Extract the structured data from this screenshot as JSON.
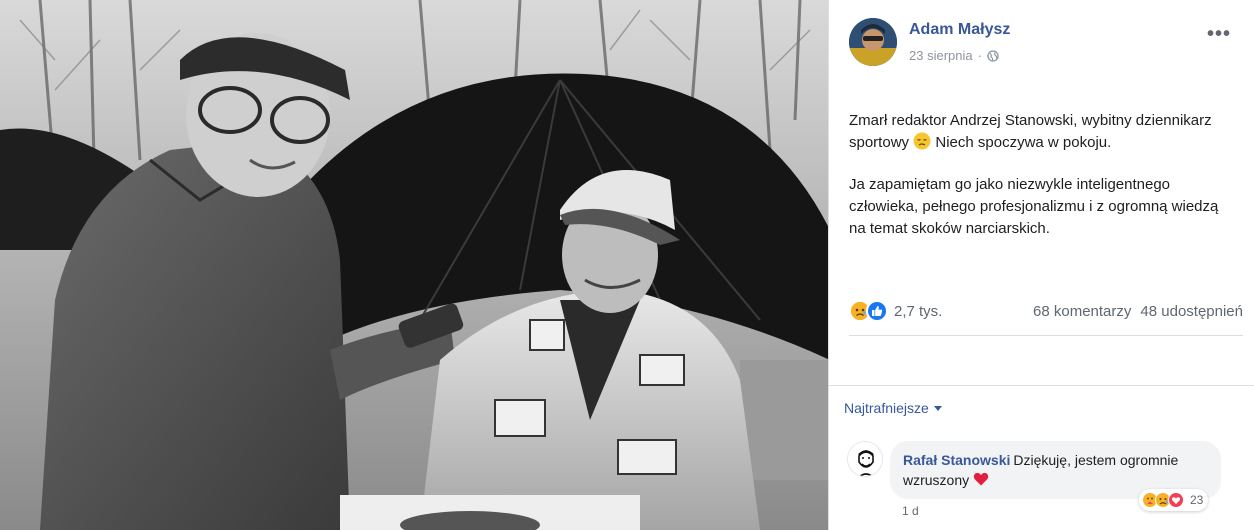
{
  "post": {
    "author": "Adam Małysz",
    "date": "23 sierpnia",
    "date_separator": "·",
    "privacy_icon": "globe-icon",
    "more_label": "•••",
    "text_line1": "Zmarł redaktor Andrzej Stanowski, wybitny dziennikarz sportowy",
    "text_line1_end": "Niech spoczywa w pokoju.",
    "text_para2": "Ja zapamiętam go jako niezwykle inteligentnego człowieka, pełnego profesjonalizmu i z ogromną wiedzą na temat skoków narciarskich."
  },
  "reactions": {
    "icons": [
      "sad-reaction-icon",
      "like-reaction-icon"
    ],
    "count": "2,7 tys.",
    "comments": "68 komentarzy",
    "shares": "48 udostępnień"
  },
  "sort": {
    "label": "Najtrafniejsze"
  },
  "comment": {
    "author": "Rafał Stanowski",
    "text": "Dziękuję, jestem ogromnie wzruszony",
    "reaction_icons": [
      "care-reaction-icon",
      "sad-reaction-icon",
      "love-reaction-icon"
    ],
    "reaction_count": "23",
    "time": "1 d"
  },
  "colors": {
    "link_blue": "#385898",
    "secondary_text": "#606770",
    "like_blue": "#1877f2",
    "love_red": "#f33e58",
    "sad_yellow": "#f7b125"
  }
}
